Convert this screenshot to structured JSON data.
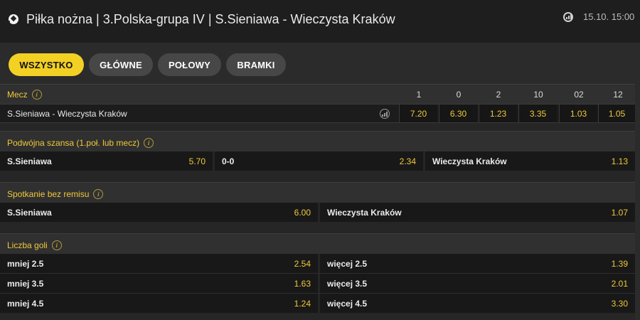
{
  "header": {
    "title": "Piłka nożna | 3.Polska-grupa IV | S.Sieniawa - Wieczysta Kraków",
    "datetime": "15.10. 15:00",
    "sport_icon": "soccer-ball-icon",
    "stats_icon": "stats-chart-icon"
  },
  "tabs": [
    {
      "label": "WSZYSTKO",
      "active": true
    },
    {
      "label": "GŁÓWNE",
      "active": false
    },
    {
      "label": "POŁOWY",
      "active": false
    },
    {
      "label": "BRAMKI",
      "active": false
    }
  ],
  "match_market": {
    "title": "Mecz",
    "columns": [
      "1",
      "0",
      "2",
      "10",
      "02",
      "12"
    ],
    "match_name": "S.Sieniawa - Wieczysta Kraków",
    "odds": [
      "7.20",
      "6.30",
      "1.23",
      "3.35",
      "1.03",
      "1.05"
    ]
  },
  "double_chance": {
    "title": "Podwójna szansa (1.poł. lub mecz)",
    "options": [
      {
        "label": "S.Sieniawa",
        "odd": "5.70"
      },
      {
        "label": "0-0",
        "odd": "2.34"
      },
      {
        "label": "Wieczysta Kraków",
        "odd": "1.13"
      }
    ]
  },
  "draw_no_bet": {
    "title": "Spotkanie bez remisu",
    "options": [
      {
        "label": "S.Sieniawa",
        "odd": "6.00"
      },
      {
        "label": "Wieczysta Kraków",
        "odd": "1.07"
      }
    ]
  },
  "total_goals": {
    "title": "Liczba goli",
    "rows": [
      {
        "under_label": "mniej 2.5",
        "under_odd": "2.54",
        "over_label": "więcej 2.5",
        "over_odd": "1.39"
      },
      {
        "under_label": "mniej 3.5",
        "under_odd": "1.63",
        "over_label": "więcej 3.5",
        "over_odd": "2.01"
      },
      {
        "under_label": "mniej 4.5",
        "under_odd": "1.24",
        "over_label": "więcej 4.5",
        "over_odd": "3.30"
      }
    ]
  },
  "colors": {
    "accent": "#f3d024",
    "odd_text": "#f0c93a",
    "background": "#262626"
  }
}
